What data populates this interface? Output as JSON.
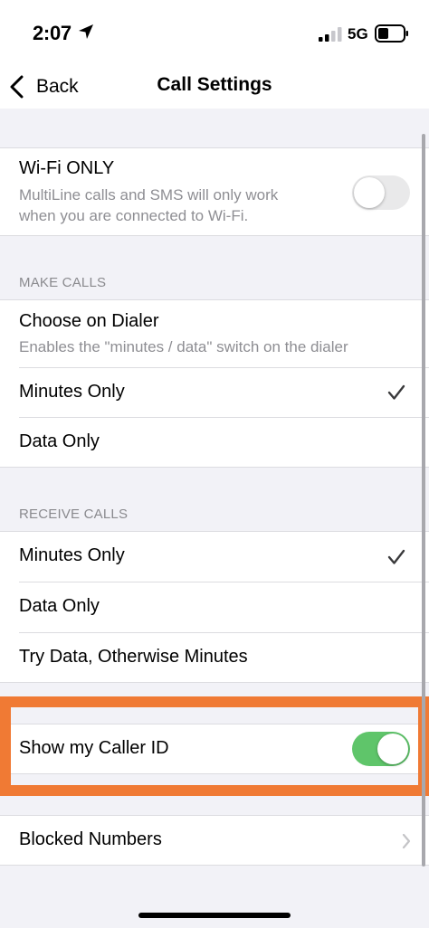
{
  "status_bar": {
    "time": "2:07",
    "network": "5G"
  },
  "nav": {
    "back_label": "Back",
    "title": "Call Settings"
  },
  "wifi_only": {
    "label": "Wi-Fi ONLY",
    "description_line1": "MultiLine calls and SMS will only work",
    "description_line2": "when you are connected to Wi-Fi.",
    "enabled": false
  },
  "make_calls": {
    "header": "MAKE CALLS",
    "choose_label": "Choose on Dialer",
    "choose_description": "Enables the \"minutes / data\" switch on the dialer",
    "options": [
      {
        "label": "Minutes Only",
        "selected": true
      },
      {
        "label": "Data Only",
        "selected": false
      }
    ]
  },
  "receive_calls": {
    "header": "RECEIVE CALLS",
    "options": [
      {
        "label": "Minutes Only",
        "selected": true
      },
      {
        "label": "Data Only",
        "selected": false
      },
      {
        "label": "Try Data, Otherwise Minutes",
        "selected": false
      }
    ]
  },
  "caller_id": {
    "label": "Show my Caller ID",
    "enabled": true
  },
  "blocked_numbers": {
    "label": "Blocked Numbers"
  },
  "colors": {
    "toggle_on": "#5fc56a",
    "highlight": "#f07a34",
    "secondary_text": "#8e8e93"
  }
}
